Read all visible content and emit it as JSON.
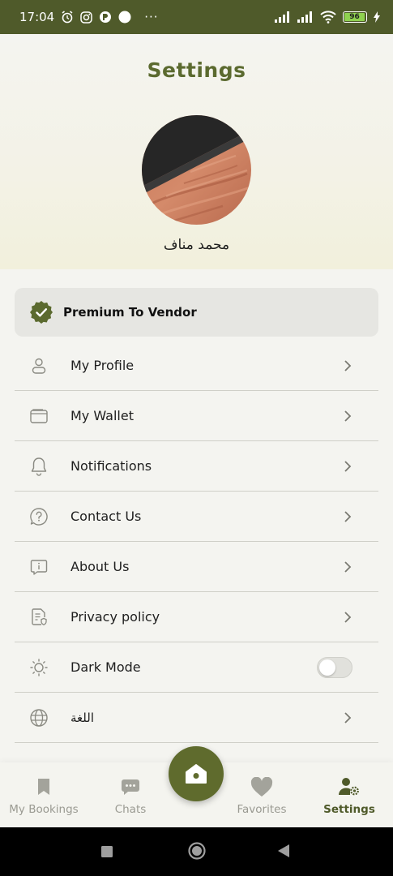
{
  "status_bar": {
    "time": "17:04",
    "dots": "···",
    "battery": "96"
  },
  "page": {
    "title": "Settings"
  },
  "profile": {
    "name": "محمد مناف"
  },
  "premium": {
    "label": "Premium To Vendor"
  },
  "menu": {
    "items": [
      {
        "label": "My Profile",
        "icon": "user-icon"
      },
      {
        "label": "My Wallet",
        "icon": "wallet-icon"
      },
      {
        "label": "Notifications",
        "icon": "bell-icon"
      },
      {
        "label": "Contact Us",
        "icon": "question-icon"
      },
      {
        "label": "About Us",
        "icon": "info-icon"
      },
      {
        "label": "Privacy policy",
        "icon": "document-shield-icon"
      },
      {
        "label": "Dark Mode",
        "icon": "sun-icon",
        "toggle": false
      },
      {
        "label": "اللغة",
        "icon": "globe-icon"
      }
    ]
  },
  "bottom_nav": {
    "items": [
      {
        "label": "My Bookings",
        "icon": "bookmark-icon"
      },
      {
        "label": "Chats",
        "icon": "chat-icon"
      },
      {
        "label": "Favorites",
        "icon": "heart-icon"
      },
      {
        "label": "Settings",
        "icon": "user-gear-icon",
        "active": true
      }
    ],
    "home_icon": "home-icon"
  },
  "colors": {
    "brand": "#5b6a2f",
    "status_bar": "#4f5a2a",
    "background": "#f4f4f0",
    "divider": "#cfcfc8"
  }
}
